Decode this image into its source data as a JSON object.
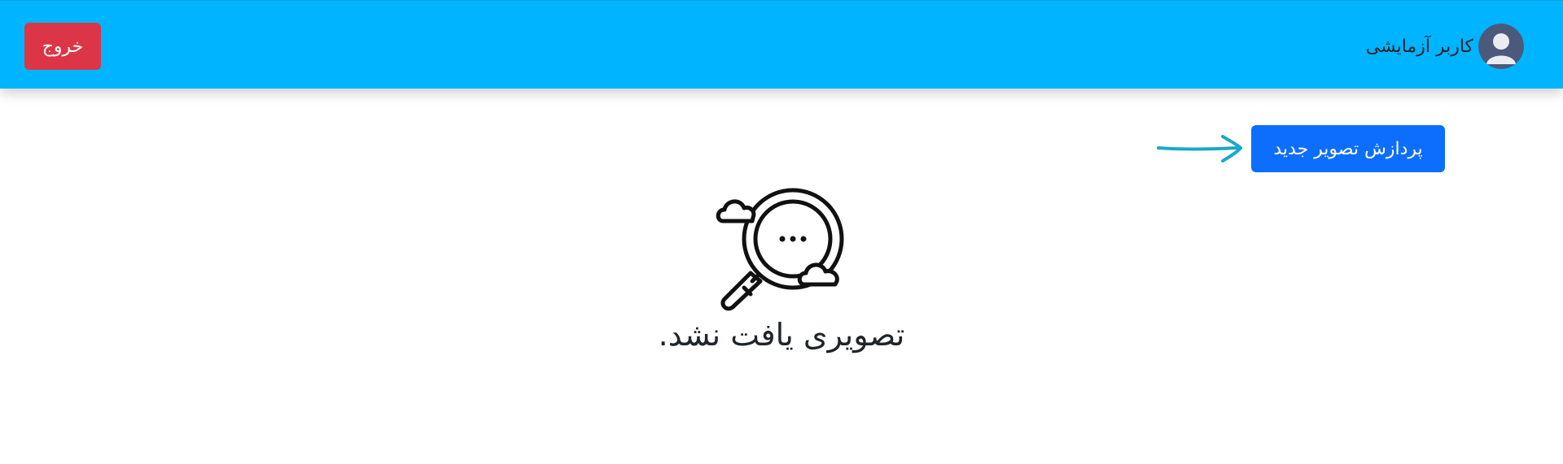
{
  "header": {
    "background_color": "#00b4ff",
    "logout_label": "خروج",
    "logout_color": "#dc3545",
    "user_name": "کاربر آزمایشی",
    "avatar_icon": "user-avatar-icon"
  },
  "main": {
    "new_image_label": "پردازش تصویر جدید",
    "new_image_color": "#0d6efd",
    "arrow_icon": "arrow-right-icon",
    "arrow_color": "#1aa7cc",
    "empty_icon": "magnifier-clouds-icon",
    "empty_message": "تصویری یافت نشد."
  }
}
